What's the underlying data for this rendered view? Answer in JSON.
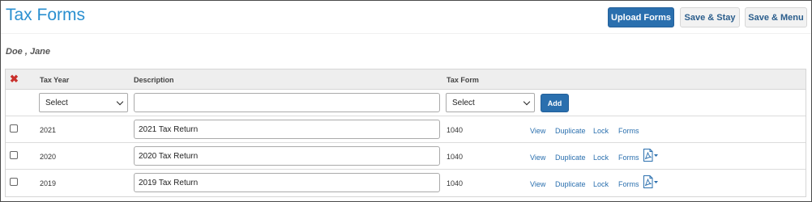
{
  "header": {
    "title": "Tax Forms",
    "upload_label": "Upload Forms",
    "save_stay_label": "Save & Stay",
    "save_menu_label": "Save & Menu"
  },
  "person": {
    "name": "Doe , Jane"
  },
  "table": {
    "columns": [
      "Tax Year",
      "Description",
      "Tax Form"
    ],
    "delete_icon": "delete-x-icon",
    "new_entry": {
      "year_select": "Select",
      "description": "",
      "form_select": "Select",
      "add_label": "Add"
    },
    "rows": [
      {
        "year": "2021",
        "description": "2021 Tax Return",
        "form": "1040",
        "actions": [
          "View",
          "Duplicate",
          "Lock",
          "Forms"
        ],
        "has_pdf": false
      },
      {
        "year": "2020",
        "description": "2020 Tax Return",
        "form": "1040",
        "actions": [
          "View",
          "Duplicate",
          "Lock",
          "Forms"
        ],
        "has_pdf": true
      },
      {
        "year": "2019",
        "description": "2019 Tax Return",
        "form": "1040",
        "actions": [
          "View",
          "Duplicate",
          "Lock",
          "Forms"
        ],
        "has_pdf": true
      }
    ]
  },
  "colors": {
    "title": "#2a8fd0",
    "primary_button": "#2a6fae",
    "link": "#2a6fae",
    "delete_icon": "#c9302c"
  }
}
